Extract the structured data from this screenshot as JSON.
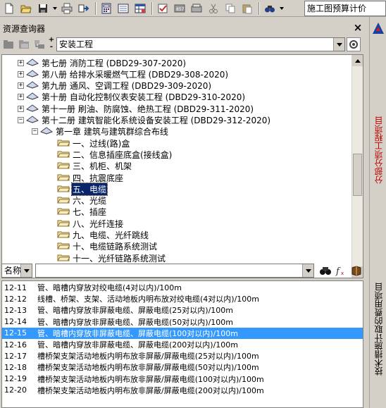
{
  "toolbar": {
    "combo_value": "施工图预算计价",
    "icons": [
      "new-file-icon",
      "open-folder-icon",
      "save-icon",
      "print-icon",
      "export-icon",
      "calculator-icon",
      "edit-icon",
      "table-icon",
      "check-icon",
      "report-icon",
      "printer-icon",
      "cut-icon",
      "copy-icon",
      "paste-icon",
      "binoculars-icon"
    ]
  },
  "panel": {
    "title": "资源查询器",
    "close": "×",
    "library_value": "安装工程",
    "plus": "+",
    "minus": "-"
  },
  "tree": {
    "items": [
      {
        "label": "第七册  消防工程 (DBD29-307-2020)",
        "level": 0,
        "expanded": false,
        "type": "book"
      },
      {
        "label": "第八册  给排水采暖燃气工程 (DBD29-308-2020)",
        "level": 0,
        "expanded": false,
        "type": "book"
      },
      {
        "label": "第九册  通风、空调工程 (DBD29-309-2020)",
        "level": 0,
        "expanded": false,
        "type": "book"
      },
      {
        "label": "第十册  自动化控制仪表安装工程 (DBD29-310-2020)",
        "level": 0,
        "expanded": false,
        "type": "book"
      },
      {
        "label": "第十一册  刷油、防腐蚀、绝热工程 (DBD29-311-2020)",
        "level": 0,
        "expanded": false,
        "type": "book"
      },
      {
        "label": "第十二册  建筑智能化系统设备安装工程 (DBD29-312-2020)",
        "level": 0,
        "expanded": true,
        "type": "book"
      },
      {
        "label": "第一章  建筑与建筑群综合布线",
        "level": 1,
        "expanded": true,
        "type": "book"
      },
      {
        "label": "一、过线(路)盒",
        "level": 2,
        "type": "folder"
      },
      {
        "label": "二、信息插座底盒(接线盒)",
        "level": 2,
        "type": "folder"
      },
      {
        "label": "三、机柜、机架",
        "level": 2,
        "type": "folder"
      },
      {
        "label": "四、抗震底座",
        "level": 2,
        "type": "folder"
      },
      {
        "label": "五、电缆",
        "level": 2,
        "type": "folder",
        "selected": true
      },
      {
        "label": "六、光缆",
        "level": 2,
        "type": "folder"
      },
      {
        "label": "七、插座",
        "level": 2,
        "type": "folder"
      },
      {
        "label": "八、光纤连接",
        "level": 2,
        "type": "folder"
      },
      {
        "label": "九、电缆、光纤跳线",
        "level": 2,
        "type": "folder"
      },
      {
        "label": "十、电缆链路系统测试",
        "level": 2,
        "type": "folder"
      },
      {
        "label": "十一、光纤链路系统测试",
        "level": 2,
        "type": "folder"
      }
    ]
  },
  "search": {
    "field_value": "名称",
    "input_value": ""
  },
  "list": {
    "rows": [
      {
        "code": "12-11",
        "name": "管、暗槽内穿放对绞电缆(4对以内)/100m"
      },
      {
        "code": "12-12",
        "name": "线槽、桥架、支架、活动地板内明布放对绞电缆(4对以内)/100m"
      },
      {
        "code": "12-13",
        "name": "管、暗槽内穿放非屏蔽电缆、屏蔽电缆(25对以内)/100m"
      },
      {
        "code": "12-14",
        "name": "管、暗槽内穿放非屏蔽电缆、屏蔽电缆(50对以内)/100m"
      },
      {
        "code": "12-15",
        "name": "管、暗槽内穿放非屏蔽电缆、屏蔽电缆(100对以内)/100m",
        "selected": true
      },
      {
        "code": "12-16",
        "name": "管、暗槽内穿放非屏蔽电缆、屏蔽电缆(200对以内)/100m"
      },
      {
        "code": "12-17",
        "name": "槽桥架支架活动地板内明布放非屏蔽/屏蔽电缆(25对以内)/100m"
      },
      {
        "code": "12-18",
        "name": "槽桥架支架活动地板内明布放非屏蔽/屏蔽电缆(50对以内)/100m"
      },
      {
        "code": "12-19",
        "name": "槽桥架支架活动地板内明布放非屏蔽/屏蔽电缆(100对以内)/100m"
      },
      {
        "code": "12-20",
        "name": "槽桥架支架活动地板内明布放非屏蔽/屏蔽电缆(200对以内)/100m"
      }
    ]
  },
  "side": {
    "tab1": "分部分项工程项目",
    "tab2": "技术措施计取的费用项目"
  },
  "colors": {
    "selection": "#0a246a",
    "list_selection": "#3399ff",
    "side_tab_text": "#c00000"
  }
}
